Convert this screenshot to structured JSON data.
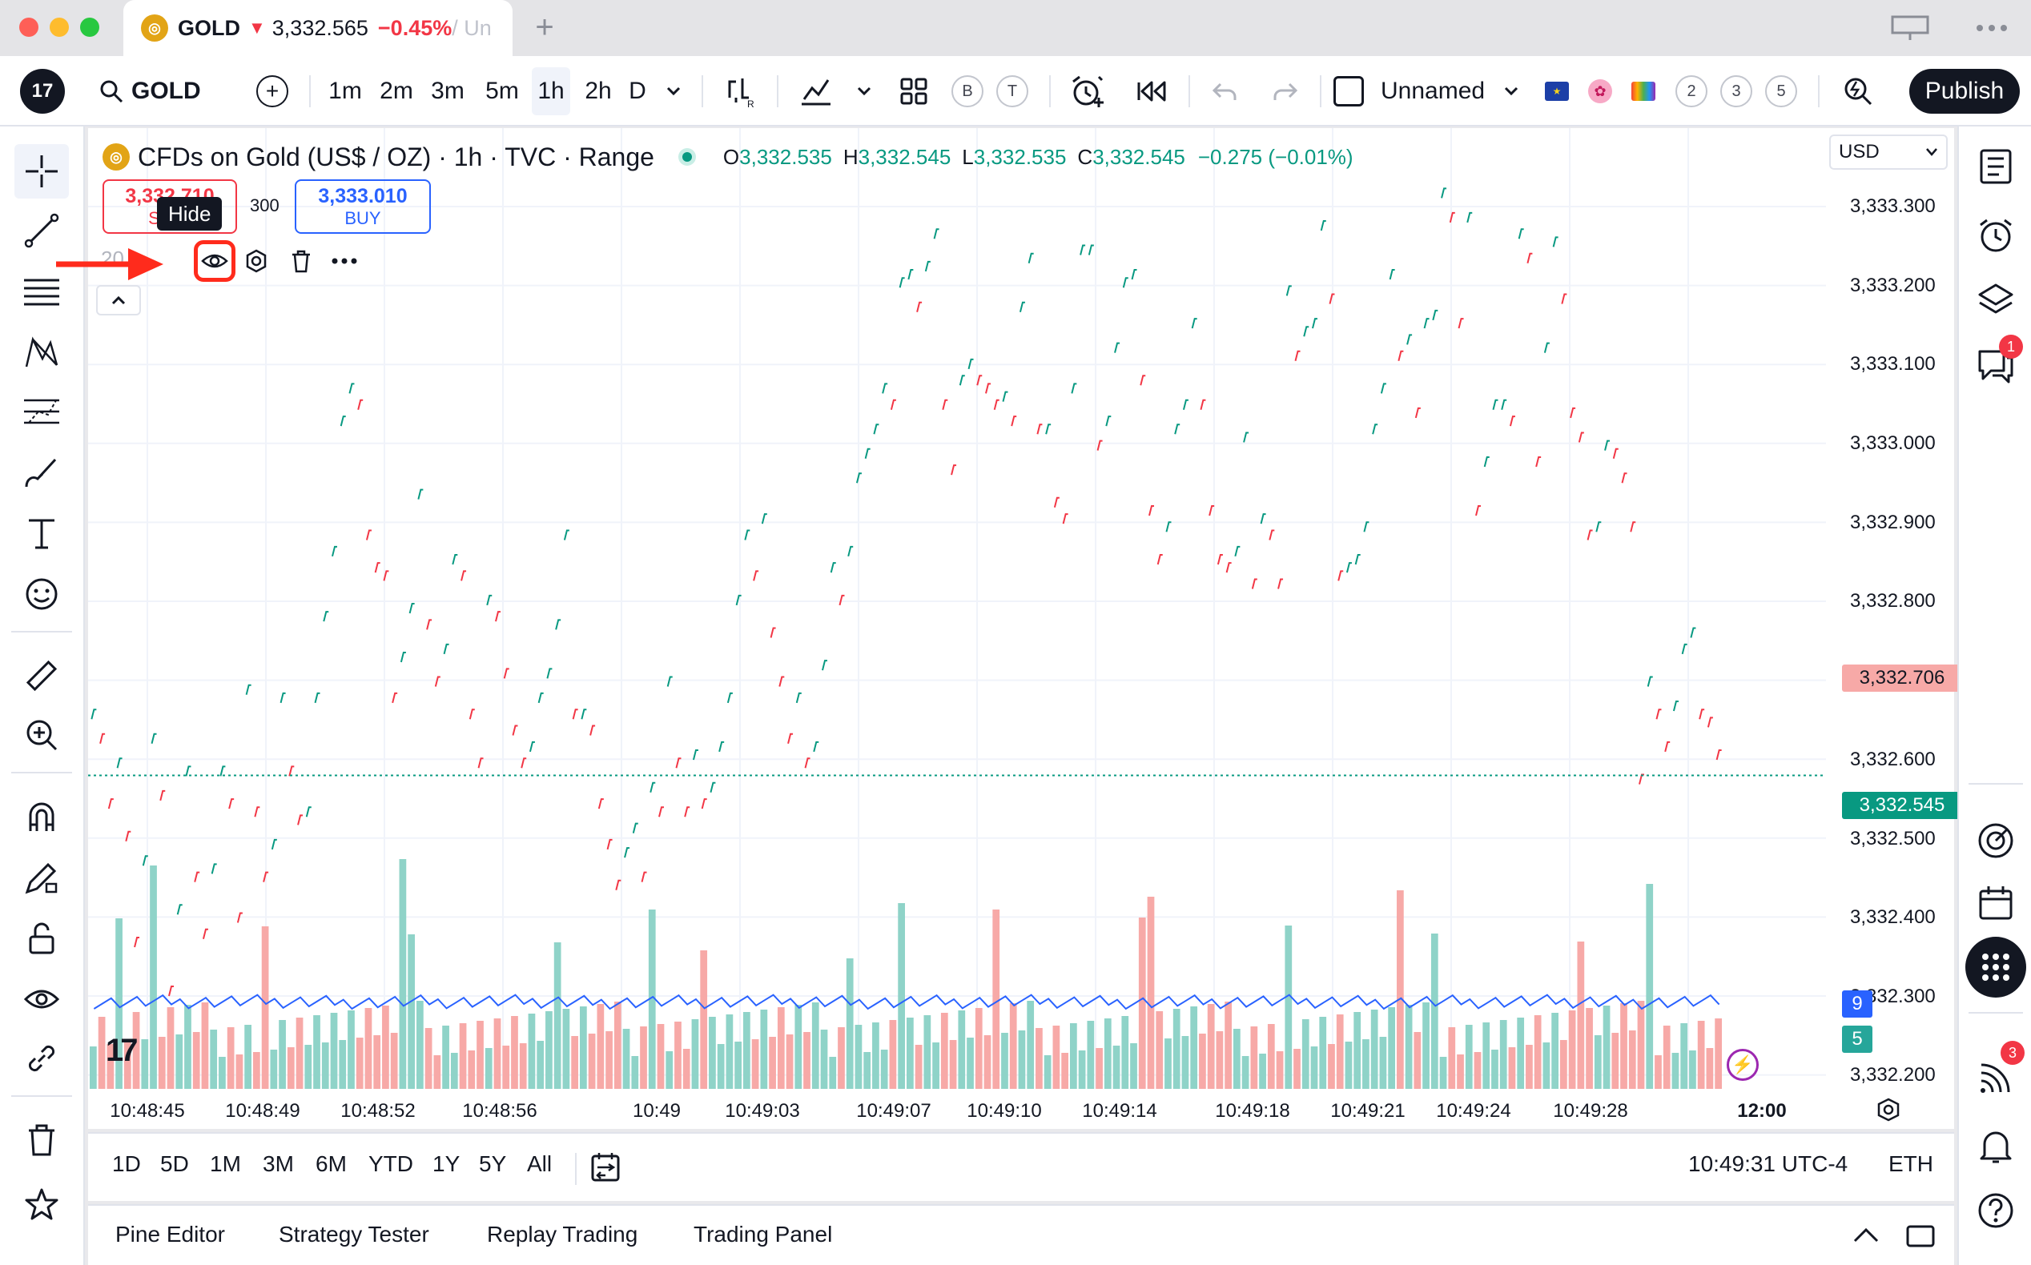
{
  "browser_tab": {
    "symbol": "GOLD",
    "direction_glyph": "▼",
    "price": "3,332.565",
    "change": "−0.45%",
    "rest": " / Un"
  },
  "new_tab_glyph": "+",
  "toolbar": {
    "symbol": "GOLD",
    "intervals": [
      "1m",
      "2m",
      "3m",
      "5m",
      "1h",
      "2h",
      "D"
    ],
    "active_interval": "1h",
    "layout_name": "Unnamed",
    "alerts_badges": [
      "B",
      "T"
    ],
    "numbered_badges": [
      "2",
      "3",
      "5"
    ],
    "publish_label": "Publish"
  },
  "legend": {
    "title": "CFDs on Gold (US$ / OZ) · 1h · TVC · Range",
    "o_label": "O",
    "o_value": "3,332.535",
    "h_label": "H",
    "h_value": "3,332.545",
    "l_label": "L",
    "l_value": "3,332.535",
    "c_label": "C",
    "c_value": "3,332.545",
    "change": "−0.275 (−0.01%)"
  },
  "trade": {
    "sell_price": "3,332.710",
    "sell_label": "SELL",
    "spread": "300",
    "buy_price": "3,333.010",
    "buy_label": "BUY"
  },
  "overlay": {
    "tooltip": "Hide",
    "indicator_label": "20"
  },
  "currency": "USD",
  "price_axis": {
    "labels": [
      "3,333.300",
      "3,333.200",
      "3,333.100",
      "3,333.000",
      "3,332.900",
      "3,332.800",
      "3,332.600",
      "3,332.500",
      "3,332.400",
      "3,332.300",
      "3,332.200"
    ],
    "last_price_badge": "3,332.706",
    "close_price_badge": "3,332.545",
    "volume_badge_blue": "9",
    "volume_badge_green": "5"
  },
  "time_axis": {
    "labels": [
      "10:48:45",
      "10:48:49",
      "10:48:52",
      "10:48:56",
      "10:49",
      "10:49:03",
      "10:49:07",
      "10:49:10",
      "10:49:14",
      "10:49:18",
      "10:49:21",
      "10:49:24",
      "10:49:28",
      "12:00"
    ]
  },
  "range_bar": {
    "ranges": [
      "1D",
      "5D",
      "1M",
      "3M",
      "6M",
      "YTD",
      "1Y",
      "5Y",
      "All"
    ],
    "clock": "10:49:31 UTC-4",
    "session": "ETH"
  },
  "bottom_panel": {
    "tabs": [
      "Pine Editor",
      "Strategy Tester",
      "Replay Trading",
      "Trading Panel"
    ]
  },
  "notifications": {
    "chat_badge": "1",
    "stream_badge": "3"
  },
  "colors": {
    "up": "#089981",
    "down": "#f23645",
    "up_volume": "#8fd3c8",
    "down_volume": "#f7a9a7",
    "ma_line": "#2962ff",
    "annotation": "#ff2b1c"
  },
  "chart_data": {
    "type": "range",
    "price_range": [
      3332.16,
      3333.34
    ],
    "series": [
      {
        "name": "price",
        "values": [
          3332.62,
          3332.59,
          3332.51,
          3332.56,
          3332.47,
          3332.34,
          3332.44,
          3332.59,
          3332.52,
          3332.28,
          3332.38,
          3332.55,
          3332.42,
          3332.35,
          3332.43,
          3332.55,
          3332.51,
          3332.37,
          3332.65,
          3332.5,
          3332.42,
          3332.46,
          3332.64,
          3332.55,
          3332.49,
          3332.5,
          3332.64,
          3332.74,
          3332.82,
          3332.98,
          3333.02,
          3333.0,
          3332.84,
          3332.8,
          3332.79,
          3332.64,
          3332.69,
          3332.75,
          3332.89,
          3332.73,
          3332.66,
          3332.7,
          3332.81,
          3332.79,
          3332.62,
          3332.56,
          3332.76,
          3332.74,
          3332.67,
          3332.6,
          3332.56,
          3332.58,
          3332.64,
          3332.67,
          3332.73,
          3332.84,
          3332.62,
          3332.62,
          3332.6,
          3332.51,
          3332.46,
          3332.41,
          3332.45,
          3332.48,
          3332.42,
          3332.53,
          3332.5,
          3332.66,
          3332.56,
          3332.5,
          3332.57,
          3332.51,
          3332.53,
          3332.58,
          3332.64,
          3332.76,
          3332.84,
          3332.79,
          3332.86,
          3332.72,
          3332.66,
          3332.59,
          3332.64,
          3332.56,
          3332.58,
          3332.68,
          3332.8,
          3332.76,
          3332.82,
          3332.91,
          3332.94,
          3332.97,
          3333.02,
          3333.0,
          3333.15,
          3333.16,
          3333.12,
          3333.17,
          3333.21,
          3333.0,
          3332.92,
          3333.03,
          3333.05,
          3333.03,
          3333.02,
          3333.0,
          3333.01,
          3332.98,
          3333.12,
          3333.18,
          3332.97,
          3332.97,
          3332.88,
          3332.86,
          3333.02,
          3333.19,
          3333.19,
          3332.95,
          3332.98,
          3333.07,
          3333.15,
          3333.16,
          3333.03,
          3332.87,
          3332.81,
          3332.85,
          3332.97,
          3333.0,
          3333.1,
          3333.0,
          3332.87,
          3332.81,
          3332.8,
          3332.82,
          3332.96,
          3332.78,
          3332.86,
          3332.84,
          3332.78,
          3333.14,
          3333.06,
          3333.09,
          3333.1,
          3333.22,
          3333.13,
          3332.79,
          3332.8,
          3332.81,
          3332.85,
          3332.97,
          3333.02,
          3333.16,
          3333.06,
          3333.08,
          3332.99,
          3333.1,
          3333.11,
          3333.26,
          3333.23,
          3333.1,
          3333.23,
          3332.87,
          3332.93,
          3333.0,
          3333.0,
          3332.98,
          3333.21,
          3333.18,
          3332.93,
          3333.07,
          3333.2,
          3333.13,
          3332.99,
          3332.96,
          3332.84,
          3332.85,
          3332.95,
          3332.94,
          3332.91,
          3332.85,
          3332.54,
          3332.66,
          3332.62,
          3332.58,
          3332.63,
          3332.7,
          3332.72,
          3332.62,
          3332.61,
          3332.57
        ]
      }
    ]
  }
}
